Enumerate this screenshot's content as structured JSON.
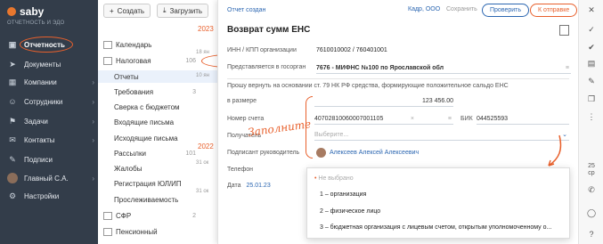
{
  "app": {
    "logo": "saby",
    "subtitle": "ОТЧЕТНОСТЬ И ЭДО"
  },
  "sidebar": {
    "items": [
      {
        "label": "Отчетность",
        "icon": "report-icon"
      },
      {
        "label": "Документы",
        "icon": "send-icon"
      },
      {
        "label": "Компании",
        "icon": "building-icon"
      },
      {
        "label": "Сотрудники",
        "icon": "people-icon"
      },
      {
        "label": "Задачи",
        "icon": "tasks-icon"
      },
      {
        "label": "Контакты",
        "icon": "contacts-icon"
      },
      {
        "label": "Подписи",
        "icon": "signature-icon"
      },
      {
        "label": "Главный С.А.",
        "icon": "avatar"
      },
      {
        "label": "Настройки",
        "icon": "gear-icon"
      }
    ]
  },
  "toolbar": {
    "create": "Создать",
    "upload": "Загрузить"
  },
  "midnav": {
    "items": [
      {
        "label": "Календарь",
        "count": ""
      },
      {
        "label": "Налоговая",
        "count": "106"
      },
      {
        "label": "Отчеты",
        "count": ""
      },
      {
        "label": "Требования",
        "count": "3"
      },
      {
        "label": "Сверка с бюджетом",
        "count": ""
      },
      {
        "label": "Входящие письма",
        "count": ""
      },
      {
        "label": "Исходящие письма",
        "count": ""
      },
      {
        "label": "Рассылки",
        "count": "101"
      },
      {
        "label": "Жалобы",
        "count": ""
      },
      {
        "label": "Регистрация ЮЛ/ИП",
        "count": ""
      },
      {
        "label": "Прослеживаемость",
        "count": ""
      },
      {
        "label": "СФР",
        "count": "2"
      },
      {
        "label": "Пенсионный",
        "count": ""
      }
    ]
  },
  "list": {
    "years": [
      "2023",
      "2022"
    ],
    "dates": [
      "18 ян",
      "10 ян",
      "31 ок",
      "31 ок"
    ]
  },
  "panel": {
    "status": "Отчет создан",
    "org": "Кадр, ООО",
    "save": "Сохранить",
    "check": "Проверить",
    "to_send": "К отправке",
    "title": "Возврат сумм ЕНС",
    "inn_label": "ИНН / КПП организации",
    "inn_value": "7610010002  /  760401001",
    "represented_label": "Представляется в госорган",
    "represented_value": "7676 - МИФНС №100 по Ярославской обл",
    "request_text": "Прошу вернуть на основании ст. 79 НК РФ средства, формирующие положительное сальдо ЕНС",
    "amount_label": "в размере",
    "amount_value": "123 456.00",
    "account_label": "Номер счета",
    "account_value": "40702810060007001105",
    "bik_label": "БИК",
    "bik_value": "044525593",
    "recipient_label": "Получатель",
    "recipient_placeholder": "Выберите...",
    "signer_label": "Подписант руководитель",
    "signer_value": "Алексеев Алексей Алексеевич",
    "phone_label": "Телефон",
    "date_label": "Дата",
    "date_value": "25.01.23",
    "handwritten": "Заполните"
  },
  "dropdown": {
    "options": [
      "Не выбрано",
      "1 – организация",
      "2 – физическое лицо",
      "3 – бюджетная организация с лицевым счетом, открытым уполномоченному о..."
    ]
  },
  "rightbar": {
    "date_day": "25",
    "date_label": "ср"
  },
  "colors": {
    "accent": "#e8602c",
    "sidebar": "#333d4a",
    "link": "#2b66b1"
  }
}
